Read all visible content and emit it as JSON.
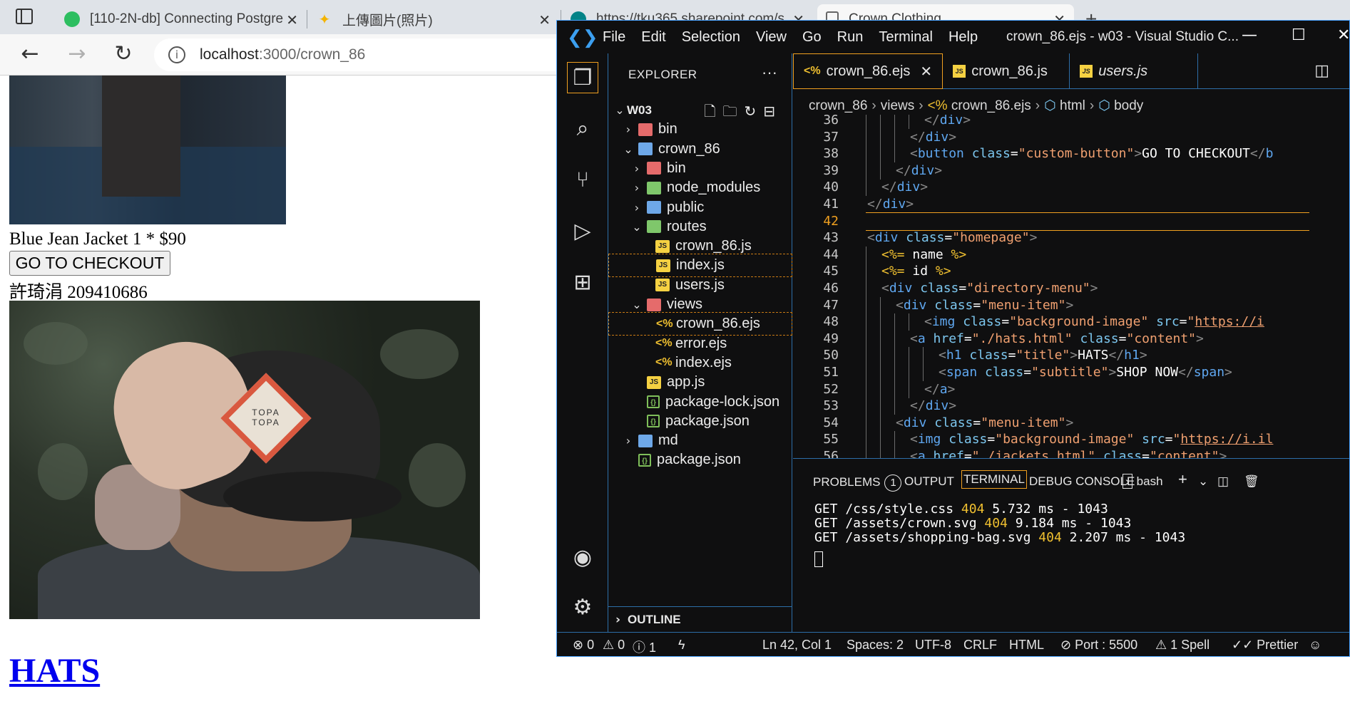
{
  "browser": {
    "tabs": [
      {
        "title": "[110-2N-db] Connecting Postgre",
        "close": "✕"
      },
      {
        "title": "上傳圖片(照片)",
        "close": "✕"
      },
      {
        "title": "https://tku365.sharepoint.com/s",
        "close": "✕"
      },
      {
        "title": "Crown Clothing",
        "close": "✕"
      }
    ],
    "new_tab": "+",
    "url_host": "localhost",
    "url_rest": ":3000/crown_86"
  },
  "page": {
    "product_line": "Blue Jean Jacket 1 * $90",
    "checkout_button": "GO TO CHECKOUT",
    "author_line": "許琦涓 209410686",
    "hat_patch_text": "TOPA\nTOPA",
    "hats_link": "HATS"
  },
  "vscode": {
    "menu": [
      "File",
      "Edit",
      "Selection",
      "View",
      "Go",
      "Run",
      "Terminal",
      "Help"
    ],
    "window_title": "crown_86.ejs - w03 - Visual Studio C...",
    "explorer_title": "EXPLORER",
    "more": "···",
    "tree": [
      {
        "label": "W03",
        "depth": 0,
        "chev": "⌄",
        "icon": "",
        "bold": true
      },
      {
        "label": "bin",
        "depth": 1,
        "chev": "›",
        "icon": "folder-red"
      },
      {
        "label": "crown_86",
        "depth": 1,
        "chev": "⌄",
        "icon": "folder"
      },
      {
        "label": "bin",
        "depth": 2,
        "chev": "›",
        "icon": "folder-red"
      },
      {
        "label": "node_modules",
        "depth": 2,
        "chev": "›",
        "icon": "folder-green"
      },
      {
        "label": "public",
        "depth": 2,
        "chev": "›",
        "icon": "folder"
      },
      {
        "label": "routes",
        "depth": 2,
        "chev": "⌄",
        "icon": "folder-green"
      },
      {
        "label": "crown_86.js",
        "depth": 3,
        "chev": "",
        "icon": "js"
      },
      {
        "label": "index.js",
        "depth": 3,
        "chev": "",
        "icon": "js",
        "sel": true
      },
      {
        "label": "users.js",
        "depth": 3,
        "chev": "",
        "icon": "js"
      },
      {
        "label": "views",
        "depth": 2,
        "chev": "⌄",
        "icon": "folder-red"
      },
      {
        "label": "crown_86.ejs",
        "depth": 3,
        "chev": "",
        "icon": "ejs",
        "sel": true
      },
      {
        "label": "error.ejs",
        "depth": 3,
        "chev": "",
        "icon": "ejs"
      },
      {
        "label": "index.ejs",
        "depth": 3,
        "chev": "",
        "icon": "ejs"
      },
      {
        "label": "app.js",
        "depth": 2,
        "chev": "",
        "icon": "js"
      },
      {
        "label": "package-lock.json",
        "depth": 2,
        "chev": "",
        "icon": "json"
      },
      {
        "label": "package.json",
        "depth": 2,
        "chev": "",
        "icon": "json"
      },
      {
        "label": "md",
        "depth": 1,
        "chev": "›",
        "icon": "folder"
      },
      {
        "label": "package.json",
        "depth": 1,
        "chev": "",
        "icon": "json"
      }
    ],
    "outline": "OUTLINE",
    "editor_tabs": [
      {
        "label": "crown_86.ejs",
        "icon": "<%",
        "active": true,
        "close": "✕"
      },
      {
        "label": "crown_86.js",
        "icon": "JS"
      },
      {
        "label": "users.js",
        "icon": "JS",
        "italic": true
      }
    ],
    "breadcrumb": [
      "crown_86",
      "views",
      "crown_86.ejs",
      "html",
      "body"
    ],
    "code_lines": [
      {
        "n": "36",
        "indent": 4,
        "parts": [
          [
            "t-punct",
            "</"
          ],
          [
            "t-tag",
            "div"
          ],
          [
            "t-punct",
            ">"
          ]
        ]
      },
      {
        "n": "37",
        "indent": 3,
        "parts": [
          [
            "t-punct",
            "</"
          ],
          [
            "t-tag",
            "div"
          ],
          [
            "t-punct",
            ">"
          ]
        ]
      },
      {
        "n": "38",
        "indent": 3,
        "parts": [
          [
            "t-punct",
            "<"
          ],
          [
            "t-tag",
            "button"
          ],
          [
            "t-attr",
            " class"
          ],
          [
            "t-txt",
            "="
          ],
          [
            "t-str",
            "\"custom-button\""
          ],
          [
            "t-punct",
            ">"
          ],
          [
            "t-txt",
            "GO TO CHECKOUT"
          ],
          [
            "t-punct",
            "</"
          ],
          [
            "t-tag",
            "b"
          ]
        ]
      },
      {
        "n": "39",
        "indent": 2,
        "parts": [
          [
            "t-punct",
            "</"
          ],
          [
            "t-tag",
            "div"
          ],
          [
            "t-punct",
            ">"
          ]
        ]
      },
      {
        "n": "40",
        "indent": 1,
        "parts": [
          [
            "t-punct",
            "</"
          ],
          [
            "t-tag",
            "div"
          ],
          [
            "t-punct",
            ">"
          ]
        ]
      },
      {
        "n": "41",
        "indent": 0,
        "parts": [
          [
            "t-punct",
            "</"
          ],
          [
            "t-tag",
            "div"
          ],
          [
            "t-punct",
            ">"
          ]
        ]
      },
      {
        "n": "42",
        "indent": 0,
        "parts": [],
        "current": true
      },
      {
        "n": "43",
        "indent": 0,
        "parts": [
          [
            "t-punct",
            "<"
          ],
          [
            "t-tag",
            "div"
          ],
          [
            "t-attr",
            " class"
          ],
          [
            "t-txt",
            "="
          ],
          [
            "t-str",
            "\"homepage\""
          ],
          [
            "t-punct",
            ">"
          ]
        ]
      },
      {
        "n": "44",
        "indent": 1,
        "parts": [
          [
            "t-ejs",
            "<%="
          ],
          [
            "t-txt",
            " name "
          ],
          [
            "t-ejs",
            "%>"
          ]
        ]
      },
      {
        "n": "45",
        "indent": 1,
        "parts": [
          [
            "t-ejs",
            "<%="
          ],
          [
            "t-txt",
            " id "
          ],
          [
            "t-ejs",
            "%>"
          ]
        ]
      },
      {
        "n": "46",
        "indent": 1,
        "parts": [
          [
            "t-punct",
            "<"
          ],
          [
            "t-tag",
            "div"
          ],
          [
            "t-attr",
            " class"
          ],
          [
            "t-txt",
            "="
          ],
          [
            "t-str",
            "\"directory-menu\""
          ],
          [
            "t-punct",
            ">"
          ]
        ]
      },
      {
        "n": "47",
        "indent": 2,
        "parts": [
          [
            "t-punct",
            "<"
          ],
          [
            "t-tag",
            "div"
          ],
          [
            "t-attr",
            " class"
          ],
          [
            "t-txt",
            "="
          ],
          [
            "t-str",
            "\"menu-item\""
          ],
          [
            "t-punct",
            ">"
          ]
        ]
      },
      {
        "n": "48",
        "indent": 4,
        "parts": [
          [
            "t-punct",
            "<"
          ],
          [
            "t-tag",
            "img"
          ],
          [
            "t-attr",
            " class"
          ],
          [
            "t-txt",
            "="
          ],
          [
            "t-str",
            "\"background-image\""
          ],
          [
            "t-attr",
            " src"
          ],
          [
            "t-txt",
            "="
          ],
          [
            "t-str",
            "\""
          ],
          [
            "t-str-u",
            "https://i"
          ]
        ]
      },
      {
        "n": "49",
        "indent": 3,
        "parts": [
          [
            "t-punct",
            "<"
          ],
          [
            "t-tag",
            "a"
          ],
          [
            "t-attr",
            " href"
          ],
          [
            "t-txt",
            "="
          ],
          [
            "t-str",
            "\"./hats.html\""
          ],
          [
            "t-attr",
            " class"
          ],
          [
            "t-txt",
            "="
          ],
          [
            "t-str",
            "\"content\""
          ],
          [
            "t-punct",
            ">"
          ]
        ]
      },
      {
        "n": "50",
        "indent": 5,
        "parts": [
          [
            "t-punct",
            "<"
          ],
          [
            "t-tag",
            "h1"
          ],
          [
            "t-attr",
            " class"
          ],
          [
            "t-txt",
            "="
          ],
          [
            "t-str",
            "\"title\""
          ],
          [
            "t-punct",
            ">"
          ],
          [
            "t-txt",
            "HATS"
          ],
          [
            "t-punct",
            "</"
          ],
          [
            "t-tag",
            "h1"
          ],
          [
            "t-punct",
            ">"
          ]
        ]
      },
      {
        "n": "51",
        "indent": 5,
        "parts": [
          [
            "t-punct",
            "<"
          ],
          [
            "t-tag",
            "span"
          ],
          [
            "t-attr",
            " class"
          ],
          [
            "t-txt",
            "="
          ],
          [
            "t-str",
            "\"subtitle\""
          ],
          [
            "t-punct",
            ">"
          ],
          [
            "t-txt",
            "SHOP NOW"
          ],
          [
            "t-punct",
            "</"
          ],
          [
            "t-tag",
            "span"
          ],
          [
            "t-punct",
            ">"
          ]
        ]
      },
      {
        "n": "52",
        "indent": 4,
        "parts": [
          [
            "t-punct",
            "</"
          ],
          [
            "t-tag",
            "a"
          ],
          [
            "t-punct",
            ">"
          ]
        ]
      },
      {
        "n": "53",
        "indent": 3,
        "parts": [
          [
            "t-punct",
            "</"
          ],
          [
            "t-tag",
            "div"
          ],
          [
            "t-punct",
            ">"
          ]
        ]
      },
      {
        "n": "54",
        "indent": 2,
        "parts": [
          [
            "t-punct",
            "<"
          ],
          [
            "t-tag",
            "div"
          ],
          [
            "t-attr",
            " class"
          ],
          [
            "t-txt",
            "="
          ],
          [
            "t-str",
            "\"menu-item\""
          ],
          [
            "t-punct",
            ">"
          ]
        ]
      },
      {
        "n": "55",
        "indent": 3,
        "parts": [
          [
            "t-punct",
            "<"
          ],
          [
            "t-tag",
            "img"
          ],
          [
            "t-attr",
            " class"
          ],
          [
            "t-txt",
            "="
          ],
          [
            "t-str",
            "\"background-image\""
          ],
          [
            "t-attr",
            " src"
          ],
          [
            "t-txt",
            "="
          ],
          [
            "t-str",
            "\""
          ],
          [
            "t-str-u",
            "https://i.il"
          ]
        ]
      },
      {
        "n": "56",
        "indent": 3,
        "parts": [
          [
            "t-punct",
            "<"
          ],
          [
            "t-tag",
            "a"
          ],
          [
            "t-attr",
            " href"
          ],
          [
            "t-txt",
            "="
          ],
          [
            "t-str",
            "\"./jackets.html\""
          ],
          [
            "t-attr",
            " class"
          ],
          [
            "t-txt",
            "="
          ],
          [
            "t-str",
            "\"content\""
          ],
          [
            "t-punct",
            ">"
          ]
        ]
      }
    ],
    "panel": {
      "problems": "PROBLEMS",
      "problems_count": "1",
      "output": "OUTPUT",
      "terminal": "TERMINAL",
      "debug": "DEBUG CONSOLE",
      "shell": "bash",
      "terminal_lines": [
        {
          "pre": "GET /css/style.css ",
          "code": "404",
          "post": " 5.732 ms - 1043"
        },
        {
          "pre": "GET /assets/crown.svg ",
          "code": "404",
          "post": " 9.184 ms - 1043"
        },
        {
          "pre": "GET /assets/shopping-bag.svg ",
          "code": "404",
          "post": " 2.207 ms - 1043"
        }
      ]
    },
    "status": {
      "errors": "⊗ 0",
      "warnings": "⚠ 0",
      "info": "ⓘ 1",
      "position": "Ln 42, Col 1",
      "spaces": "Spaces: 2",
      "encoding": "UTF-8",
      "eol": "CRLF",
      "language": "HTML",
      "port": "⊘ Port : 5500",
      "spell": "⚠ 1 Spell",
      "prettier": "✓✓ Prettier"
    }
  },
  "colors": {
    "accent": "#f0a020",
    "border": "#2d6ea8",
    "link": "#0000ee"
  }
}
